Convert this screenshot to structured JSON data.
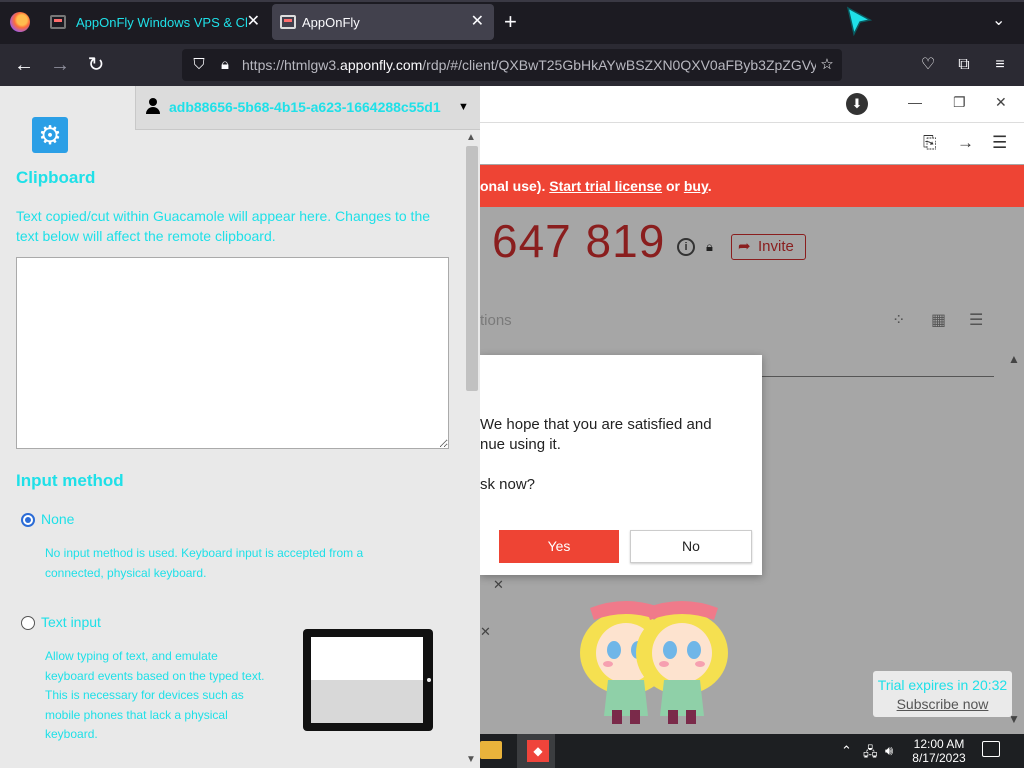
{
  "browser": {
    "tabs": [
      {
        "label": "AppOnFly Windows VPS & Clo"
      },
      {
        "label": "AppOnFly"
      }
    ],
    "url_prefix": "https://htmlgw3.",
    "url_domain": "apponfly.com",
    "url_suffix": "/rdp/#/client/QXBwT25GbHkAYwBSZXN0QXV0aFByb3ZpZGVy"
  },
  "guac": {
    "username": "adb88656-5b68-4b15-a623-1664288c55d1",
    "clipboard": {
      "title": "Clipboard",
      "description": "Text copied/cut within Guacamole will appear here. Changes to the text below will affect the remote clipboard.",
      "value": ""
    },
    "input_method": {
      "title": "Input method",
      "options": [
        {
          "label": "None",
          "selected": true,
          "description_lines": [
            "No input method is used. Keyboard input is accepted from a",
            "connected, physical keyboard."
          ]
        },
        {
          "label": "Text input",
          "selected": false,
          "description_lines": [
            "Allow typing of text, and emulate",
            "keyboard events based on the typed text.",
            "This is necessary for devices such as",
            "mobile phones that lack a physical",
            "keyboard."
          ]
        }
      ]
    }
  },
  "remote": {
    "banner": {
      "prefix": "onal use). ",
      "link1": "Start trial license",
      "middle": " or ",
      "link2": "buy",
      "suffix": "."
    },
    "id_number": "647 819",
    "invite_label": "Invite",
    "partial_tab": "tions",
    "dialog": {
      "line1": "We hope that you are satisfied and",
      "line2": "nue using it.",
      "line3": "sk now?",
      "yes": "Yes",
      "no": "No"
    },
    "trial": {
      "text": "Trial expires in 20:32",
      "link": "Subscribe now"
    },
    "taskbar": {
      "time": "12:00 AM",
      "date": "8/17/2023"
    }
  }
}
